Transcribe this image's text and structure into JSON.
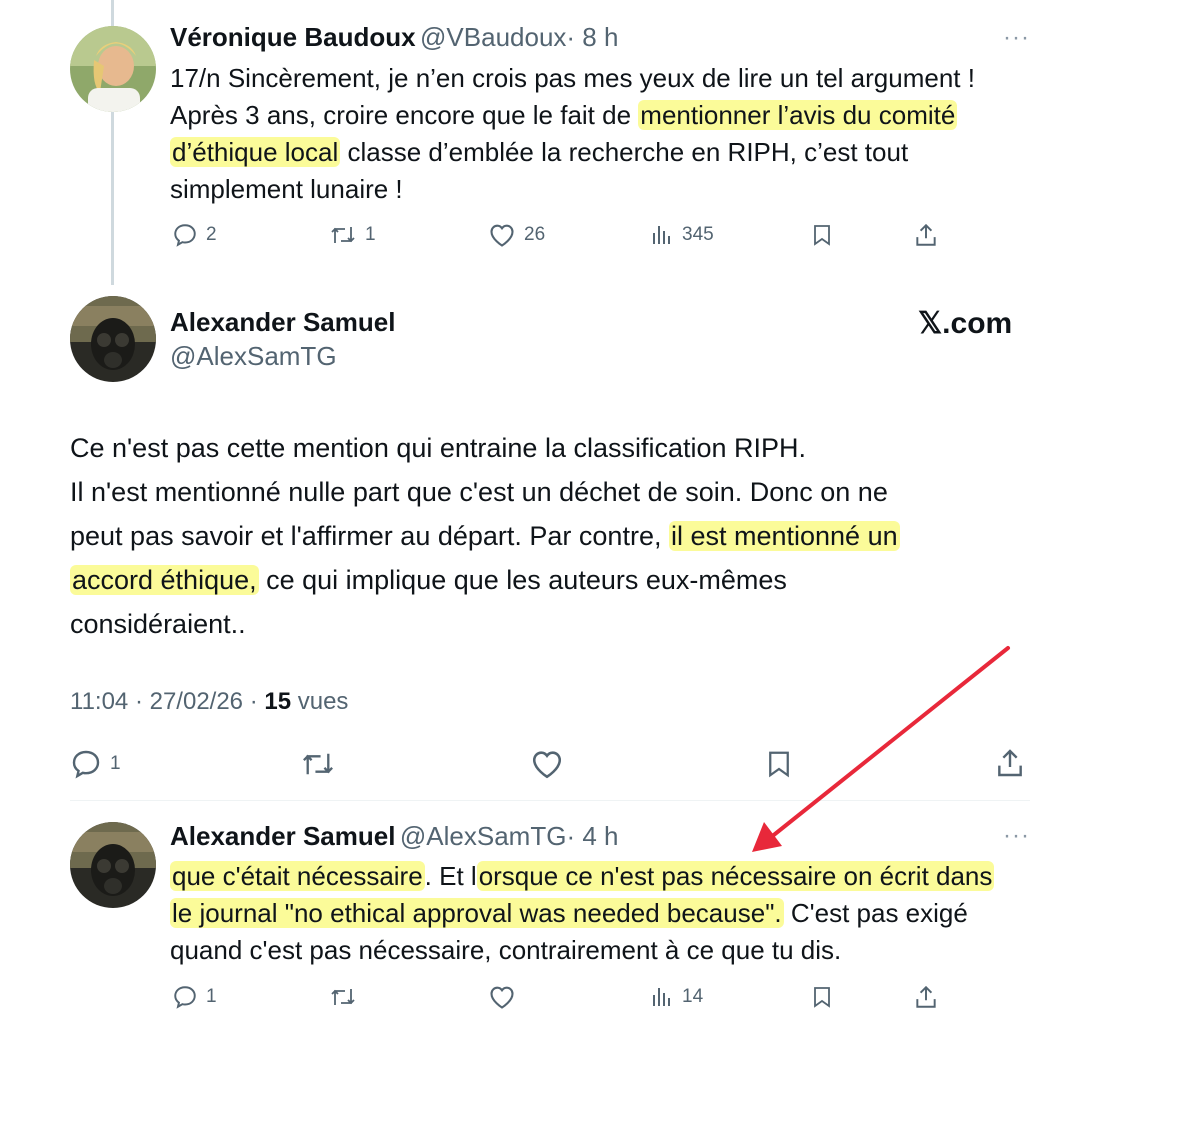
{
  "tweet1": {
    "name": "Véronique Baudoux",
    "handle": "@VBaudoux",
    "time": "· 8 h",
    "lines": [
      [
        "17/n Sincèrement, je n’en crois pas mes yeux de lire un tel argument  !"
      ],
      [
        "Après 3 ans, croire encore que le fait de ",
        "mentionner l’avis du comité"
      ],
      [
        "d’éthique local",
        " classe d’emblée la recherche en RIPH, c’est tout"
      ],
      [
        "simplement lunaire !"
      ]
    ],
    "replies": "2",
    "retweets": "1",
    "likes": "26",
    "views": "345"
  },
  "tweet2": {
    "name": "Alexander Samuel",
    "handle": "@AlexSamTG",
    "brand": "𝕏.com",
    "line1": "Ce n'est pas cette mention qui entraine la classification RIPH.",
    "line2": "Il n'est mentionné nulle part que c'est un déchet de soin. Donc on ne",
    "line3a": "peut pas savoir et l'affirmer au départ. Par contre, ",
    "line3b": "il est mentionné un",
    "line4a": "accord éthique,",
    "line4b": " ce qui implique que les auteurs eux-mêmes",
    "line5": "considéraient..",
    "timestamp": "11:04 · 27/02/26 ·",
    "views_count": "15",
    "views_label": "vues",
    "replies": "1"
  },
  "tweet3": {
    "name": "Alexander Samuel",
    "handle": "@AlexSamTG",
    "time": "· 4 h",
    "line1a": "que c'était nécessaire",
    "line1b": ". Et l",
    "line1c": "orsque ce n'est pas nécessaire on écrit dans",
    "line2a": "le journal \"no ethical approval was needed because\".",
    "line2b": " C'est pas exigé",
    "line3": "quand c'est pas nécessaire, contrairement à ce que tu dis.",
    "replies": "1",
    "views": "14"
  },
  "more_icon": "···",
  "colors": {
    "highlight": "#f7f746",
    "arrow": "#e8283a",
    "muted": "#536471"
  }
}
